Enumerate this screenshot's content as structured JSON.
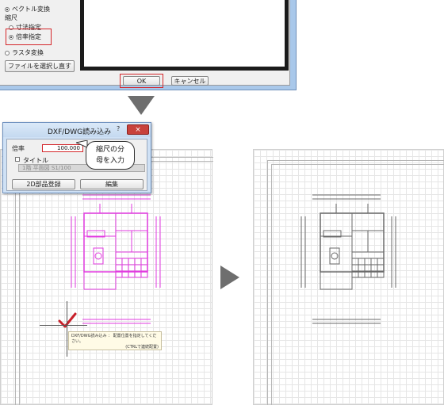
{
  "top_dialog": {
    "options": [
      {
        "label": "ベクトル変換",
        "selected": true,
        "type": "radio"
      },
      {
        "label": "縮尺",
        "type": "heading"
      },
      {
        "label": "寸法指定",
        "selected": false,
        "type": "radio"
      },
      {
        "label": "倍率指定",
        "selected": true,
        "type": "radio"
      },
      {
        "label": "ラスタ変換",
        "selected": false,
        "type": "radio"
      }
    ],
    "reselect_file_button": "ファイルを選択し直す",
    "ok_button": "OK",
    "cancel_button": "キャンセル"
  },
  "dxf_dialog": {
    "title": "DXF/DWG読み込み",
    "help": "?",
    "close": "×",
    "scale_label": "倍率",
    "scale_value": "100.000",
    "title_checkbox_label": "タイトル",
    "title_field_value": "1階 平面図 S1/100",
    "register_button": "2D部品登録",
    "edit_button": "編集"
  },
  "callout": {
    "line1": "縮尺の分",
    "line2": "母を入力"
  },
  "status_tip": {
    "line1": "DXF/DWG読み込み ： 配置位置を指定してください。",
    "line2": "(CTRLで連続配置)"
  },
  "colors": {
    "highlight_red": "#d4262a",
    "plan_magenta": "#e23be0",
    "plan_gray": "#6a6a6a",
    "check_red": "#c8202a"
  }
}
